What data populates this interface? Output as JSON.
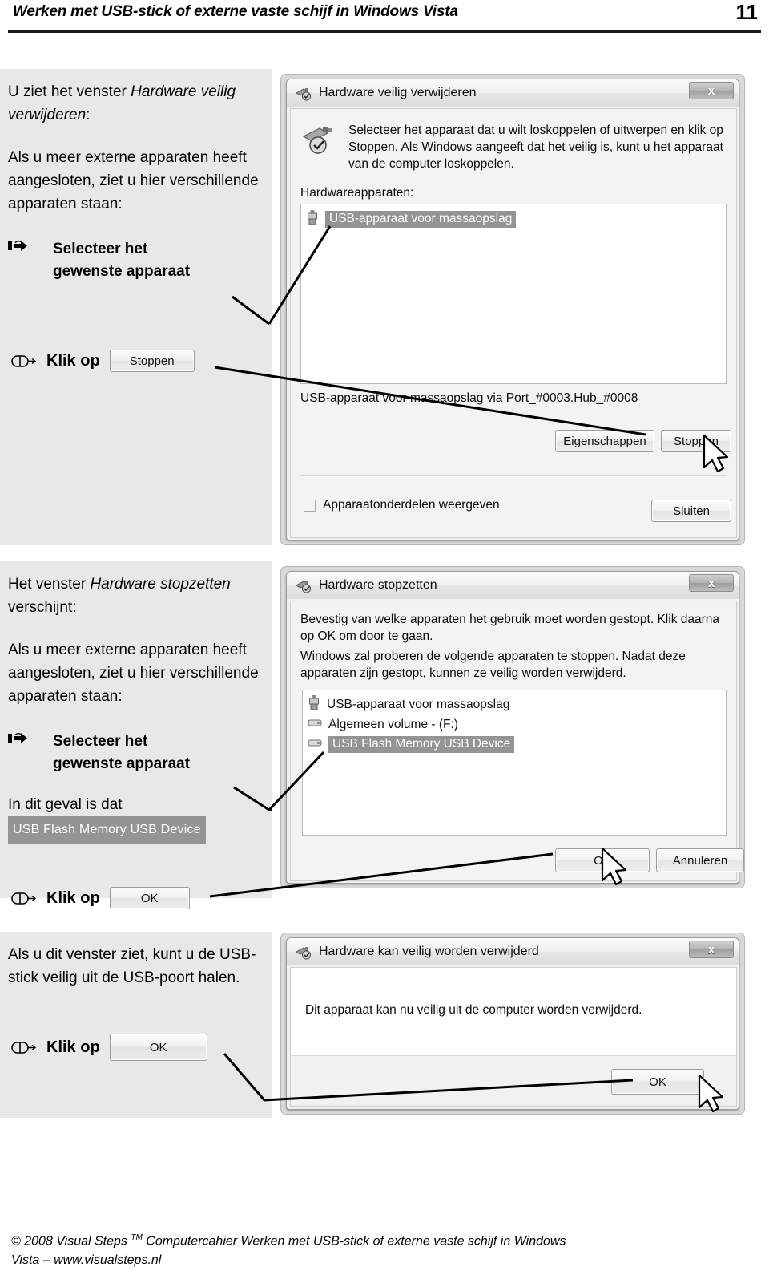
{
  "header": {
    "title": "Werken met USB-stick of externe vaste schijf in Windows Vista",
    "page_number": "11"
  },
  "sections": [
    {
      "id": "section-1",
      "text_lines": [
        "U ziet het venster ",
        "Hardware veilig verwijderen",
        ":"
      ],
      "intro_plain_1": "U ziet het venster ",
      "intro_italic_1": "Hardware veilig verwijderen",
      "intro_tail_1": ":",
      "body": "Als u meer externe apparaten heeft aangesloten, ziet u hier verschillende apparaten staan:",
      "step_glyph": "pointing-hand",
      "step_label_line1": "Selecteer het",
      "step_label_line2": "gewenste apparaat",
      "click_label": "Klik op",
      "click_button": "Stoppen"
    },
    {
      "id": "section-2",
      "intro_plain_1": "Het venster ",
      "intro_italic_1": "Hardware stopzetten",
      "intro_tail_1": " verschijnt:",
      "body": "Als u meer externe apparaten heeft aangesloten, ziet u hier verschillende apparaten staan:",
      "step_label_line1": "Selecteer het",
      "step_label_line2": "gewenste apparaat",
      "note_label": "In dit geval is dat",
      "note_highlight": "USB Flash Memory USB Device",
      "click_label": "Klik op",
      "click_button": "OK"
    },
    {
      "id": "section-3",
      "body": "Als u dit venster ziet, kunt u de USB-stick veilig uit de USB-poort halen.",
      "click_label": "Klik op",
      "click_button": "OK"
    }
  ],
  "dialog1": {
    "title": "Hardware veilig verwijderen",
    "close_label": "x",
    "intro": "Selecteer het apparaat dat u wilt loskoppelen of uitwerpen en klik op Stoppen. Als Windows aangeeft dat het veilig is, kunt u het apparaat van de computer loskoppelen.",
    "list_label": "Hardwareapparaten:",
    "list_items": [
      {
        "label": "USB-apparaat voor massaopslag",
        "icon": "usb-device-icon",
        "selected": true
      }
    ],
    "status": "USB-apparaat voor massaopslag via Port_#0003.Hub_#0008",
    "btn_properties": "Eigenschappen",
    "btn_stop": "Stoppen",
    "checkbox_label": "Apparaatonderdelen weergeven",
    "checkbox_checked": false,
    "btn_close": "Sluiten"
  },
  "dialog2": {
    "title": "Hardware stopzetten",
    "close_label": "x",
    "para1": "Bevestig van welke apparaten het gebruik moet worden gestopt. Klik daarna op OK om door te gaan.",
    "para2": "Windows zal proberen de volgende apparaten te stoppen. Nadat deze apparaten zijn gestopt, kunnen ze veilig worden verwijderd.",
    "list_items": [
      {
        "label": "USB-apparaat voor massaopslag",
        "icon": "usb-device-icon",
        "selected": false
      },
      {
        "label": "Algemeen volume - (F:)",
        "icon": "drive-icon",
        "selected": false
      },
      {
        "label": "USB Flash Memory USB Device",
        "icon": "drive-icon",
        "selected": true
      }
    ],
    "btn_ok": "OK",
    "btn_cancel": "Annuleren"
  },
  "dialog3": {
    "title": "Hardware kan veilig worden verwijderd",
    "close_label": "x",
    "message": "Dit apparaat kan nu veilig uit de computer worden verwijderd.",
    "btn_ok": "OK"
  },
  "footer": {
    "line1_a": "© 2008 Visual Steps ",
    "line1_sup": "TM",
    "line1_b": " Computercahier Werken met USB-stick of externe vaste schijf in Windows",
    "line2": "Vista – www.visualsteps.nl"
  },
  "colors": {
    "panel_bg": "#e8e8e8",
    "dialog_bg": "#f3f3f3",
    "selection": "#949494",
    "rule": "#1b1b1b"
  }
}
